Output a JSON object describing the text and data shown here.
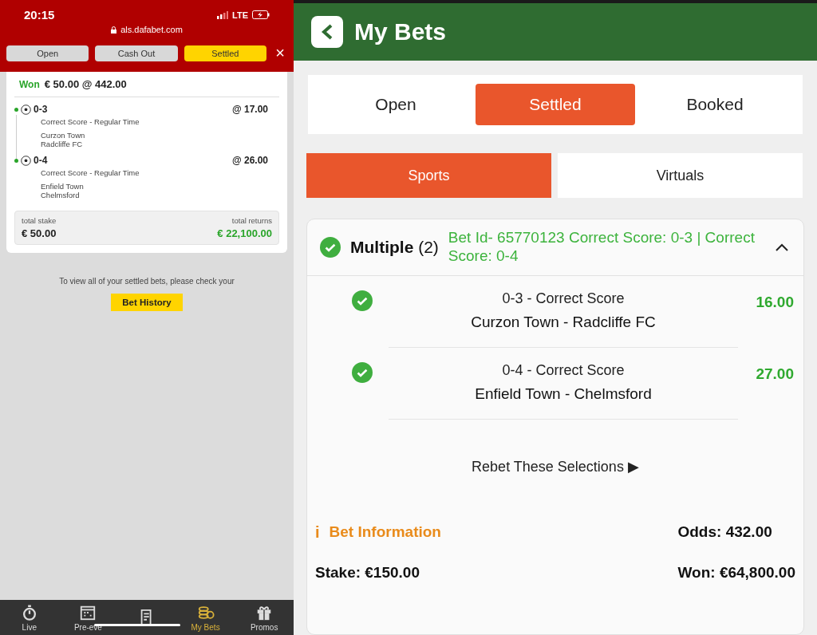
{
  "left": {
    "status_bar": {
      "time": "20:15",
      "network": "LTE",
      "url": "als.dafabet.com"
    },
    "tabs": [
      {
        "label": "Open",
        "selected": false
      },
      {
        "label": "Cash Out",
        "selected": false
      },
      {
        "label": "Settled",
        "selected": true
      }
    ],
    "close": "×",
    "bet": {
      "result": "Won",
      "summary": "€ 50.00 @ 442.00",
      "legs": [
        {
          "score": "0-3",
          "odds": "@ 17.00",
          "market": "Correct Score - Regular Time",
          "home": "Curzon Town",
          "away": "Radcliffe FC"
        },
        {
          "score": "0-4",
          "odds": "@ 26.00",
          "market": "Correct Score - Regular Time",
          "home": "Enfield Town",
          "away": "Chelmsford"
        }
      ],
      "stake_label": "total stake",
      "stake": "€ 50.00",
      "returns_label": "total returns",
      "returns": "€ 22,100.00"
    },
    "note": "To view all of your settled bets, please check your",
    "history_button": "Bet History",
    "nav": [
      {
        "kind": "live",
        "label": "Live",
        "selected": false
      },
      {
        "kind": "calendar",
        "label": "Pre-eve",
        "selected": false
      },
      {
        "kind": "slip",
        "selected": false
      },
      {
        "kind": "coins",
        "label": "My Bets",
        "selected": true
      },
      {
        "kind": "gift",
        "label": "Promos",
        "selected": false
      }
    ]
  },
  "right": {
    "title": "My Bets",
    "tabs": [
      {
        "label": "Open",
        "selected": false
      },
      {
        "label": "Settled",
        "selected": true
      },
      {
        "label": "Booked",
        "selected": false
      }
    ],
    "subtabs": [
      {
        "label": "Sports",
        "selected": true
      },
      {
        "label": "Virtuals",
        "selected": false
      }
    ],
    "bet": {
      "type": "Multiple",
      "count": "(2)",
      "description": "Bet Id- 65770123 Correct Score: 0-3 | Correct Score: 0-4",
      "expanded": true,
      "selections": [
        {
          "market": "0-3 - Correct Score",
          "event": "Curzon Town - Radcliffe FC",
          "odds": "16.00"
        },
        {
          "market": "0-4 - Correct Score",
          "event": "Enfield Town - Chelmsford",
          "odds": "27.00"
        }
      ],
      "rebet": "Rebet These Selections ▶",
      "info_icon": "i",
      "info_title": "Bet Information",
      "odds": "Odds: 432.00",
      "stake": "Stake: €150.00",
      "won": "Won: €64,800.00"
    }
  }
}
